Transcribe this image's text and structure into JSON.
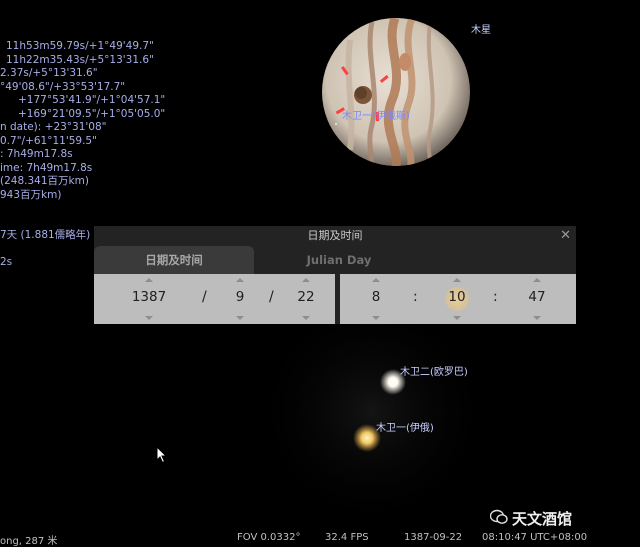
{
  "info_lines": [
    "11h53m59.79s/+1°49'49.7\"",
    "11h22m35.43s/+5°13'31.6\"",
    "2.37s/+5°13'31.6\"",
    "°49'08.6\"/+33°53'17.7\"",
    "+177°53'41.9\"/+1°04'57.1\"",
    "+169°21'09.5\"/+1°05'05.0\"",
    "n date): +23°31'08\"",
    "0.7\"/+61°11'59.5\"",
    ": 7h49m17.8s",
    "ime: 7h49m17.8s",
    "(248.341百万km)",
    "943百万km)",
    "",
    "",
    "7天 (1.881儒略年)",
    "",
    "2s"
  ],
  "sky_labels": {
    "jupiter": "木星",
    "io_overlay": "木卫一(伊俄斯)",
    "europa": "木卫二(欧罗巴)",
    "io": "木卫一(伊俄)"
  },
  "dialog": {
    "title": "日期及时间",
    "close": "✕",
    "tabs": [
      "日期及时间",
      "Julian Day"
    ],
    "date": {
      "year": "1387",
      "sep1": "/",
      "month": "9",
      "sep2": "/",
      "day": "22"
    },
    "time": {
      "hour": "8",
      "sep1": ":",
      "minute": "10",
      "sep2": ":",
      "second": "47"
    }
  },
  "status": {
    "location": "ong, 287 米",
    "fov": "FOV 0.0332°",
    "fps": "32.4 FPS",
    "date": "1387-09-22",
    "time": "08:10:47 UTC+08:00"
  },
  "watermark": "天文酒馆",
  "colors": {
    "info_text": "#a8aee8",
    "panel_bg": "#bdbdbd",
    "highlight": "#e8cf9a"
  }
}
